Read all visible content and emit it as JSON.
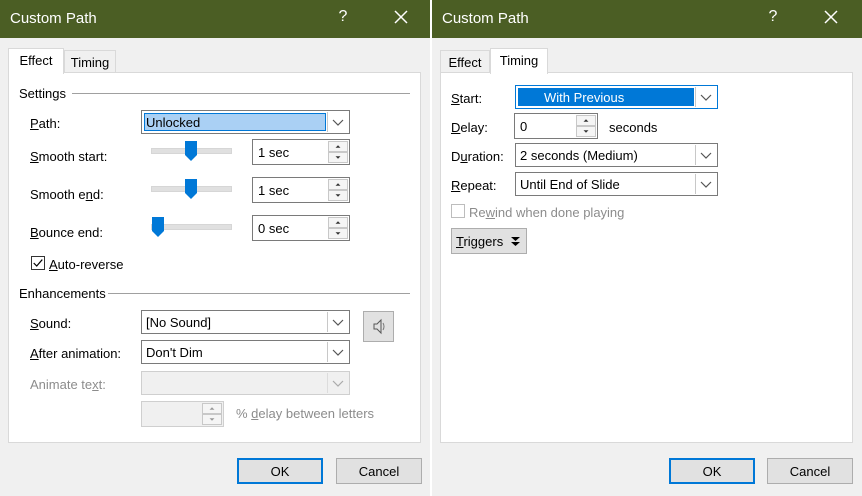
{
  "left_dialog": {
    "title": "Custom Path",
    "help": "?",
    "tabs": [
      {
        "label": "Effect",
        "active": true
      },
      {
        "label": "Timing",
        "active": false
      }
    ],
    "settings": {
      "group_label": "Settings",
      "path": {
        "label_pre": "",
        "label_u": "P",
        "label_post": "ath:",
        "value": "Unlocked"
      },
      "smooth_start": {
        "label_pre": "",
        "label_u": "S",
        "label_post": "mooth start:",
        "value": "1 sec",
        "slider_fraction": 0.5
      },
      "smooth_end": {
        "label_pre": "Smooth e",
        "label_u": "n",
        "label_post": "d:",
        "value": "1 sec",
        "slider_fraction": 0.5
      },
      "bounce_end": {
        "label_pre": "",
        "label_u": "B",
        "label_post": "ounce end:",
        "value": "0 sec",
        "slider_fraction": 0.0
      },
      "auto_reverse": {
        "label_pre": "",
        "label_u": "A",
        "label_post": "uto-reverse",
        "checked": true
      }
    },
    "enhancements": {
      "group_label": "Enhancements",
      "sound": {
        "label_pre": "",
        "label_u": "S",
        "label_post": "ound:",
        "value": "[No Sound]"
      },
      "after_animation": {
        "label_pre": "",
        "label_u": "A",
        "label_post": "fter animation:",
        "value": "Don't Dim"
      },
      "animate_text": {
        "label_pre": "Animate te",
        "label_u": "x",
        "label_post": "t:",
        "value": ""
      },
      "delay_between": {
        "value": "",
        "label_pre": "% ",
        "label_u": "d",
        "label_post": "elay between letters"
      }
    },
    "ok": "OK",
    "cancel": "Cancel"
  },
  "right_dialog": {
    "title": "Custom Path",
    "help": "?",
    "tabs": [
      {
        "label": "Effect",
        "active": false
      },
      {
        "label": "Timing",
        "active": true
      }
    ],
    "start": {
      "label_pre": "",
      "label_u": "S",
      "label_post": "tart:",
      "value": "With Previous"
    },
    "delay": {
      "label_pre": "",
      "label_u": "D",
      "label_post": "elay:",
      "value": "0",
      "unit": "seconds"
    },
    "duration": {
      "label_pre": "D",
      "label_u": "u",
      "label_post": "ration:",
      "value": "2 seconds (Medium)"
    },
    "repeat": {
      "label_pre": "",
      "label_u": "R",
      "label_post": "epeat:",
      "value": "Until End of Slide"
    },
    "rewind": {
      "label_pre": "Re",
      "label_u": "w",
      "label_post": "ind when done playing",
      "checked": false
    },
    "triggers": {
      "label_pre": "",
      "label_u": "T",
      "label_post": "riggers"
    },
    "ok": "OK",
    "cancel": "Cancel"
  },
  "colors": {
    "titlebar": "#4b5e24",
    "accent": "#0078d7",
    "thumb": "#0078d7"
  }
}
